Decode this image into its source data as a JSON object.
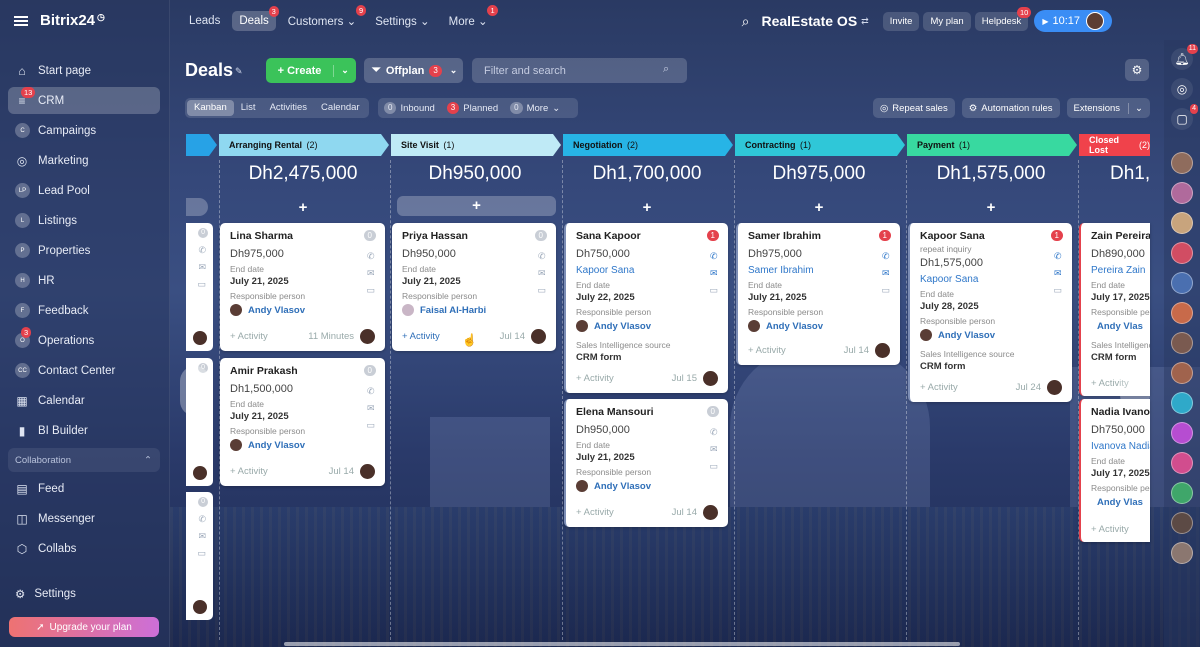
{
  "brand": {
    "name": "Bitrix24"
  },
  "sidebar": {
    "items": [
      {
        "label": "Start page",
        "icon": "house-icon"
      },
      {
        "label": "CRM",
        "badge": "13",
        "icon": "filter-icon"
      },
      {
        "label": "Campaings",
        "circle": "C"
      },
      {
        "label": "Marketing",
        "icon": "target-icon"
      },
      {
        "label": "Lead Pool",
        "circle": "LP"
      },
      {
        "label": "Listings",
        "circle": "L"
      },
      {
        "label": "Properties",
        "circle": "P"
      },
      {
        "label": "HR",
        "circle": "H"
      },
      {
        "label": "Feedback",
        "circle": "F"
      },
      {
        "label": "Operations",
        "circle": "O",
        "badge": "3"
      },
      {
        "label": "Contact Center",
        "circle": "CC"
      },
      {
        "label": "Calendar",
        "icon": "calendar-icon"
      },
      {
        "label": "BI Builder",
        "icon": "chart-icon"
      }
    ],
    "section": "Collaboration",
    "collab_items": [
      {
        "label": "Feed"
      },
      {
        "label": "Messenger"
      },
      {
        "label": "Collabs"
      }
    ],
    "settings": "Settings",
    "upgrade": "Upgrade your plan"
  },
  "topnav": {
    "tabs": [
      {
        "label": "Leads"
      },
      {
        "label": "Deals",
        "badge": "3"
      },
      {
        "label": "Customers",
        "badge": "9",
        "dd": "⌄"
      },
      {
        "label": "Settings",
        "dd": "⌄"
      },
      {
        "label": "More",
        "badge": "1",
        "dd": "⌄"
      }
    ],
    "workspace": "RealEstate OS",
    "invite": "Invite",
    "myplan": "My plan",
    "helpdesk": "Helpdesk",
    "helpdesk_badge": "10",
    "time": "10:17"
  },
  "rail": {
    "bell_badge": "11",
    "chat_badge": "4"
  },
  "page": {
    "title": "Deals",
    "create_label": "Create",
    "filter_label": "Offplan",
    "filter_count": "3",
    "search_placeholder": "Filter and search",
    "views": [
      "Kanban",
      "List",
      "Activities",
      "Calendar"
    ],
    "counters": [
      {
        "n": "0",
        "label": "Inbound"
      },
      {
        "n": "3",
        "label": "Planned"
      },
      {
        "n": "0",
        "label": "More"
      }
    ],
    "tools": [
      "Repeat sales",
      "Automation rules",
      "Extensions"
    ]
  },
  "stages": [
    {
      "label": "Arranging Rental",
      "count": "(2)",
      "sum": "Dh2,475,000",
      "color": "#8fd8f0"
    },
    {
      "label": "Site Visit",
      "count": "(1)",
      "sum": "Dh950,000",
      "color": "#bfeaf6"
    },
    {
      "label": "Negotiation",
      "count": "(2)",
      "sum": "Dh1,700,000",
      "color": "#27b4e6"
    },
    {
      "label": "Contracting",
      "count": "(1)",
      "sum": "Dh975,000",
      "color": "#2fc7d8"
    },
    {
      "label": "Payment",
      "count": "(1)",
      "sum": "Dh1,575,000",
      "color": "#38d9a0"
    },
    {
      "label": "Closed Lost",
      "count": "(2)",
      "sum": "Dh1,6",
      "color": "#f0424b"
    }
  ],
  "cards": {
    "c1": {
      "name": "Lina Sharma",
      "price": "Dh975,000",
      "end_label": "End date",
      "end": "July 21, 2025",
      "resp_label": "Responsible person",
      "person": "Andy Vlasov",
      "activity": "+ Activity",
      "time": "11 Minutes",
      "badge": "0"
    },
    "c2": {
      "name": "Amir Prakash",
      "price": "Dh1,500,000",
      "end_label": "End date",
      "end": "July 21, 2025",
      "resp_label": "Responsible person",
      "person": "Andy Vlasov",
      "activity": "+ Activity",
      "time": "Jul 14",
      "badge": "0"
    },
    "c3": {
      "name": "Priya Hassan",
      "price": "Dh950,000",
      "end_label": "End date",
      "end": "July 21, 2025",
      "resp_label": "Responsible person",
      "person": "Faisal Al-Harbi",
      "activity": "+ Activity",
      "time": "Jul 14",
      "badge": "0"
    },
    "c4": {
      "name": "Sana Kapoor",
      "price": "Dh750,000",
      "contact": "Kapoor Sana",
      "end_label": "End date",
      "end": "July 22, 2025",
      "resp_label": "Responsible person",
      "person": "Andy Vlasov",
      "src_label": "Sales Intelligence source",
      "src": "CRM form",
      "activity": "+ Activity",
      "time": "Jul 15",
      "badge": "1"
    },
    "c5": {
      "name": "Elena Mansouri",
      "price": "Dh950,000",
      "end_label": "End date",
      "end": "July 21, 2025",
      "resp_label": "Responsible person",
      "person": "Andy Vlasov",
      "activity": "+ Activity",
      "time": "Jul 14",
      "badge": "0"
    },
    "c6": {
      "name": "Samer Ibrahim",
      "price": "Dh975,000",
      "contact": "Samer Ibrahim",
      "end_label": "End date",
      "end": "July 21, 2025",
      "resp_label": "Responsible person",
      "person": "Andy Vlasov",
      "activity": "+ Activity",
      "time": "Jul 14",
      "badge": "1"
    },
    "c7": {
      "name": "Kapoor Sana",
      "sub": "repeat inquiry",
      "price": "Dh1,575,000",
      "contact": "Kapoor Sana",
      "end_label": "End date",
      "end": "July 28, 2025",
      "resp_label": "Responsible person",
      "person": "Andy Vlasov",
      "src_label": "Sales Intelligence source",
      "src": "CRM form",
      "activity": "+ Activity",
      "time": "Jul 24",
      "badge": "1"
    },
    "c8": {
      "name": "Zain Pereira",
      "price": "Dh890,000",
      "contact": "Pereira Zain",
      "end_label": "End date",
      "end": "July 17, 2025",
      "resp_label": "Responsible person",
      "person": "Andy Vlas",
      "src_label": "Sales Intelligence source",
      "src": "CRM form",
      "activity": "+ Activity"
    },
    "c9": {
      "name": "Nadia Ivanova",
      "price": "Dh750,000",
      "contact": "Ivanova Nadia",
      "end_label": "End date",
      "end": "July 17, 2025",
      "resp_label": "Responsible person",
      "person": "Andy Vlas",
      "activity": "+ Activity"
    }
  },
  "mini_badges": [
    "0",
    "0",
    "0"
  ]
}
